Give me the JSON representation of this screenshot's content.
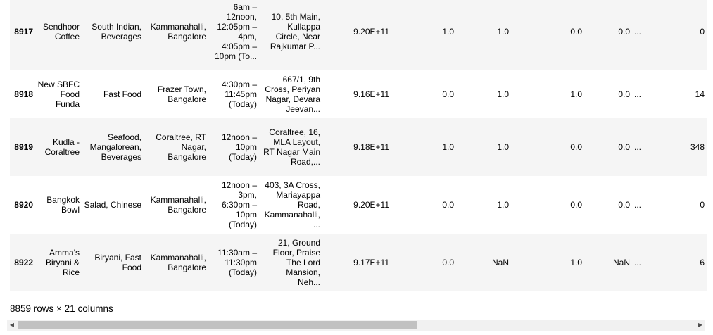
{
  "rows": [
    {
      "index": "8917",
      "name": "Sendhoor Coffee",
      "cuisines": "South Indian, Beverages",
      "location": "Kammanahalli, Bangalore",
      "timings": "6am – 12noon, 12:05pm – 4pm, 4:05pm – 10pm (To...",
      "address": "10, 5th Main, Kullappa Circle, Near Rajkumar P...",
      "phone": "9.20E+11",
      "c7": "1.0",
      "c8": "1.0",
      "c9": "0.0",
      "c10": "0.0",
      "dots": "...",
      "last": "0"
    },
    {
      "index": "8918",
      "name": "New SBFC Food Funda",
      "cuisines": "Fast Food",
      "location": "Frazer Town, Bangalore",
      "timings": "4:30pm – 11:45pm (Today)",
      "address": "667/1, 9th Cross, Periyan Nagar, Devara Jeevan...",
      "phone": "9.16E+11",
      "c7": "0.0",
      "c8": "1.0",
      "c9": "1.0",
      "c10": "0.0",
      "dots": "...",
      "last": "14"
    },
    {
      "index": "8919",
      "name": "Kudla - Coraltree",
      "cuisines": "Seafood, Mangalorean, Beverages",
      "location": "Coraltree, RT Nagar, Bangalore",
      "timings": "12noon – 10pm (Today)",
      "address": "Coraltree, 16, MLA Layout, RT Nagar Main Road,...",
      "phone": "9.18E+11",
      "c7": "1.0",
      "c8": "1.0",
      "c9": "0.0",
      "c10": "0.0",
      "dots": "...",
      "last": "348"
    },
    {
      "index": "8920",
      "name": "Bangkok Bowl",
      "cuisines": "Salad, Chinese",
      "location": "Kammanahalli, Bangalore",
      "timings": "12noon – 3pm, 6:30pm – 10pm (Today)",
      "address": "403, 3A Cross, Mariayappa Road, Kammanahalli, ...",
      "phone": "9.20E+11",
      "c7": "0.0",
      "c8": "1.0",
      "c9": "0.0",
      "c10": "0.0",
      "dots": "...",
      "last": "0"
    },
    {
      "index": "8922",
      "name": "Amma's Biryani & Rice",
      "cuisines": "Biryani, Fast Food",
      "location": "Kammanahalli, Bangalore",
      "timings": "11:30am – 11:30pm (Today)",
      "address": "21, Ground Floor, Praise The Lord Mansion, Neh...",
      "phone": "9.17E+11",
      "c7": "0.0",
      "c8": "NaN",
      "c9": "1.0",
      "c10": "NaN",
      "dots": "...",
      "last": "6"
    }
  ],
  "footer": "8859 rows × 21 columns",
  "scrollbar": {
    "left_arrow": "◀",
    "right_arrow": "▶",
    "thumb_fraction": 0.59
  }
}
